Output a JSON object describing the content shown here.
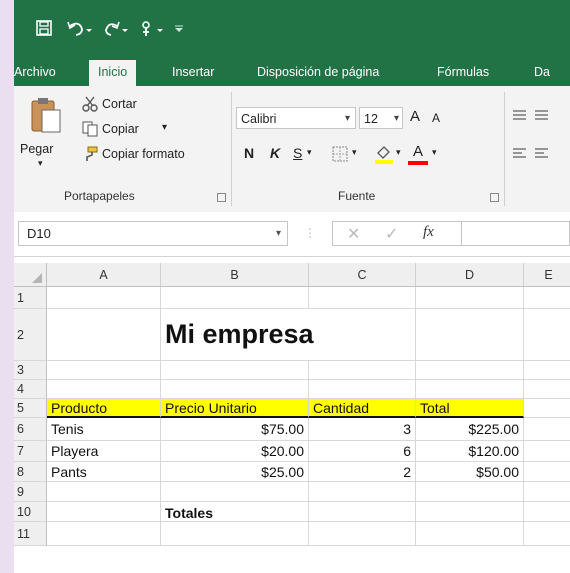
{
  "quick_access": {
    "save_icon": "save-icon",
    "undo_icon": "undo-icon",
    "redo_icon": "redo-icon",
    "touch_icon": "touch-mode-icon",
    "customize_icon": "customize-qat-icon"
  },
  "tabs": [
    "Archivo",
    "Inicio",
    "Insertar",
    "Disposición de página",
    "Fórmulas",
    "Da"
  ],
  "active_tab": "Inicio",
  "ribbon": {
    "clipboard": {
      "paste": "Pegar",
      "cut": "Cortar",
      "copy": "Copiar",
      "format_painter": "Copiar formato",
      "group_label": "Portapapeles"
    },
    "font": {
      "font_name": "Calibri",
      "font_size": "12",
      "bold": "N",
      "italic": "K",
      "underline": "S",
      "group_label": "Fuente",
      "grow": "A",
      "shrink": "A",
      "font_color": "A"
    },
    "accent_colors": {
      "fill": "#ffff00",
      "font": "#ff0000"
    }
  },
  "formula_bar": {
    "name_box": "D10",
    "fx": "fx",
    "value": ""
  },
  "grid": {
    "columns": [
      "A",
      "B",
      "C",
      "D",
      "E"
    ],
    "rows": [
      "1",
      "2",
      "3",
      "4",
      "5",
      "6",
      "7",
      "8",
      "9",
      "10",
      "11"
    ],
    "title": "Mi empresa",
    "headers": [
      "Producto",
      "Precio Unitario",
      "Cantidad",
      "Total"
    ],
    "data": [
      [
        "Tenis",
        "$75.00",
        "3",
        "$225.00"
      ],
      [
        "Playera",
        "$20.00",
        "6",
        "$120.00"
      ],
      [
        "Pants",
        "$25.00",
        "2",
        "$50.00"
      ]
    ],
    "totals_label": "Totales"
  },
  "colors": {
    "excel_green": "#217346",
    "header_fill": "#ffff00",
    "background": "#eadff0"
  }
}
